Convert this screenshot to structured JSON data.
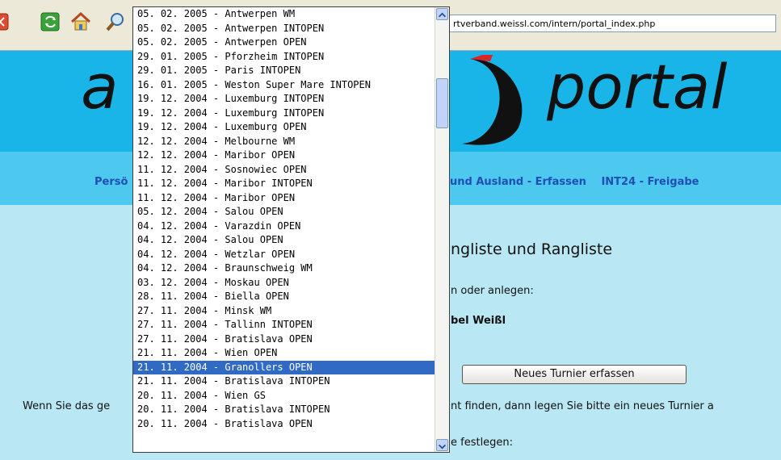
{
  "browser": {
    "address_url": "rtverband.weissl.com/intern/portal_index.php",
    "buttons": [
      "stop-icon",
      "refresh-icon",
      "home-icon",
      "search-icon"
    ]
  },
  "header": {
    "logo_left": "a",
    "logo_right": "portal"
  },
  "nav": {
    "left_label": "Persö",
    "right_items": [
      "und Ausland - Erfassen",
      "INT24 - Freigabe"
    ]
  },
  "content": {
    "heading": "ngliste und Rangliste",
    "sub1": "n oder anlegen:",
    "name": "bel Weißl",
    "new_button_label": "Neues Turnier erfassen",
    "para_left": "Wenn Sie das ge",
    "para_right": "nt finden, dann legen Sie bitte ein neues Turnier a",
    "para_bottom": "e festlegen:"
  },
  "dropdown": {
    "selected_index": 26,
    "items": [
      "05. 02. 2005 - Antwerpen WM",
      "05. 02. 2005 - Antwerpen INTOPEN",
      "05. 02. 2005 - Antwerpen OPEN",
      "29. 01. 2005 - Pforzheim INTOPEN",
      "29. 01. 2005 - Paris INTOPEN",
      "16. 01. 2005 - Weston Super Mare INTOPEN",
      "19. 12. 2004 - Luxemburg INTOPEN",
      "19. 12. 2004 - Luxemburg INTOPEN",
      "19. 12. 2004 - Luxemburg OPEN",
      "12. 12. 2004 - Melbourne WM",
      "12. 12. 2004 - Maribor OPEN",
      "11. 12. 2004 - Sosnowiec OPEN",
      "11. 12. 2004 - Maribor INTOPEN",
      "11. 12. 2004 - Maribor OPEN",
      "05. 12. 2004 - Salou OPEN",
      "04. 12. 2004 - Varazdin OPEN",
      "04. 12. 2004 - Salou OPEN",
      "04. 12. 2004 - Wetzlar OPEN",
      "04. 12. 2004 - Braunschweig WM",
      "03. 12. 2004 - Moskau OPEN",
      "28. 11. 2004 - Biella OPEN",
      "27. 11. 2004 - Minsk WM",
      "27. 11. 2004 - Tallinn INTOPEN",
      "27. 11. 2004 - Bratislava OPEN",
      "21. 11. 2004 - Wien OPEN",
      "21. 11. 2004 - Granollers OPEN",
      "21. 11. 2004 - Bratislava INTOPEN",
      "20. 11. 2004 - Wien GS",
      "20. 11. 2004 - Bratislava INTOPEN",
      "20. 11. 2004 - Bratislava OPEN"
    ]
  },
  "colors": {
    "banner": "#19b5e8",
    "navbar": "#4dc8ee",
    "background": "#b9e7f3",
    "selection": "#316ac5",
    "nav_text": "#1f4fb3"
  }
}
